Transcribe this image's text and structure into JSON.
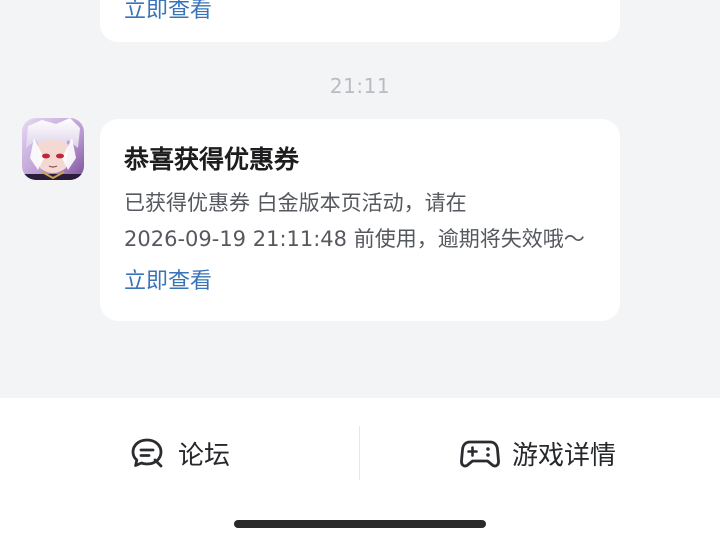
{
  "top_card": {
    "link_label": "立即查看"
  },
  "timestamp": "21:11",
  "message": {
    "title": "恭喜获得优惠券",
    "body_line1": "已获得优惠券 白金版本页活动，请在",
    "body_line2": "2026-09-19 21:11:48 前使用，逾期将失效哦～",
    "link_label": "立即查看"
  },
  "bottom_nav": {
    "forum_label": "论坛",
    "game_details_label": "游戏详情"
  },
  "colors": {
    "background": "#f3f4f6",
    "card": "#ffffff",
    "link": "#3a74b8",
    "timestamp": "#b8bcc2"
  },
  "icons": {
    "avatar": "anime-character-avatar",
    "forum": "chat-bubble-icon",
    "game": "gamepad-icon"
  }
}
